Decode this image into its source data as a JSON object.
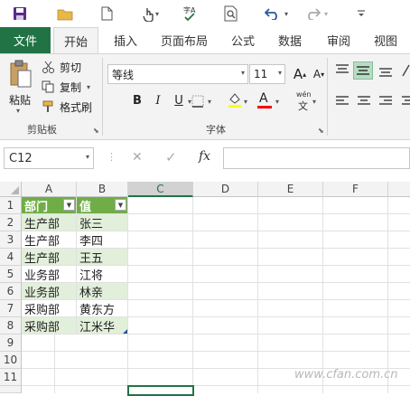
{
  "qat": {
    "icons": [
      "save-icon",
      "open-folder-icon",
      "new-document-icon",
      "touch-mode-icon",
      "spelling-icon",
      "print-preview-icon",
      "undo-icon",
      "redo-icon",
      "customize-qat-icon"
    ]
  },
  "tabs": {
    "file": "文件",
    "home": "开始",
    "insert": "插入",
    "page_layout": "页面布局",
    "formulas": "公式",
    "data": "数据",
    "review": "审阅",
    "view": "视图"
  },
  "clipboard": {
    "paste": "粘贴",
    "cut": "剪切",
    "copy": "复制",
    "format_painter": "格式刷",
    "group_label": "剪贴板"
  },
  "font": {
    "name": "等线",
    "size": "11",
    "bold": "B",
    "italic": "I",
    "underline": "U",
    "grow": "A",
    "shrink": "A",
    "font_color": "A",
    "phonetic": "wén",
    "group_label": "字体"
  },
  "formula_bar": {
    "name_box": "C12",
    "cancel": "✕",
    "enter": "✓",
    "fx": "fx",
    "value": ""
  },
  "grid": {
    "columns": [
      "A",
      "B",
      "C",
      "D",
      "E",
      "F"
    ],
    "rows": [
      "1",
      "2",
      "3",
      "4",
      "5",
      "6",
      "7",
      "8",
      "9",
      "10",
      "11"
    ],
    "header": [
      "部门",
      "值"
    ],
    "data": [
      [
        "生产部",
        "张三"
      ],
      [
        "生产部",
        "李四"
      ],
      [
        "生产部",
        "王五"
      ],
      [
        "业务部",
        "江将"
      ],
      [
        "业务部",
        "林亲"
      ],
      [
        "采购部",
        "黄东方"
      ],
      [
        "采购部",
        "江米华"
      ]
    ],
    "watermark": "www.cfan.com.cn"
  },
  "colors": {
    "excel_green": "#217346",
    "table_header": "#70ad47",
    "table_band": "#e2efda"
  }
}
